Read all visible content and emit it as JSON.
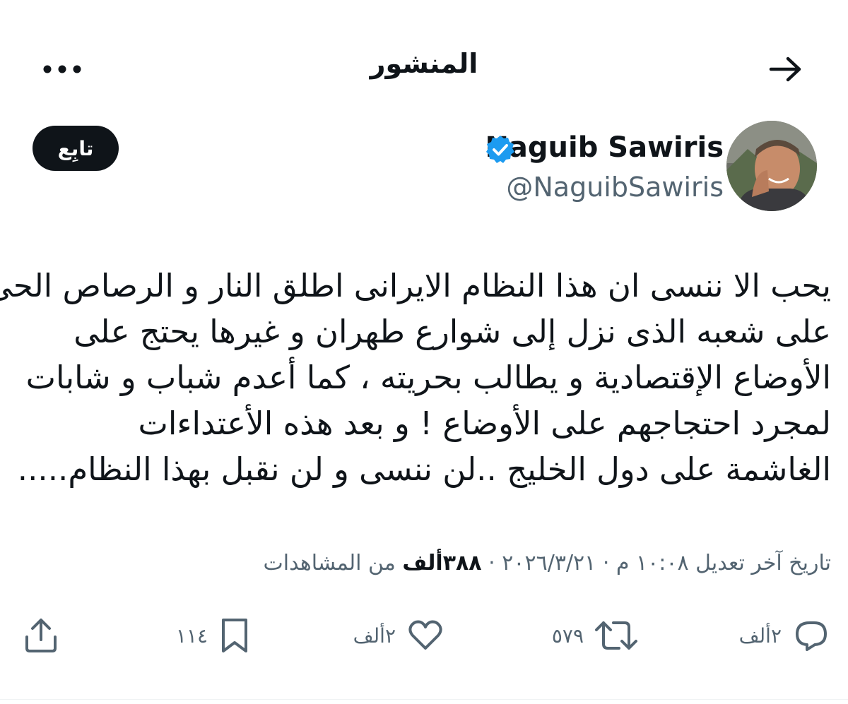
{
  "header": {
    "title": "المنشور",
    "back_icon": "arrow-right-icon",
    "more_icon": "more-horizontal-icon"
  },
  "author": {
    "display_name": "Naguib Sawiris",
    "handle": "@NaguibSawiris",
    "verified_color": "#1d9bf0",
    "follow_label": "تابِع"
  },
  "tweet": {
    "lines": [
      "يحب الا ننسى ان هذا النظام الايرانى اطلق النار و الرصاص الحى",
      "على شعبه الذى نزل إلى شوارع طهران و غيرها يحتج على",
      "الأوضاع الإقتصادية و يطالب بحريته ، كما أعدم شباب و شابات",
      "لمجرد احتجاجهم على الأوضاع ! و بعد هذه الأعتداءات",
      "الغاشمة على دول الخليج ..لن ننسى و لن نقبل بهذا النظام....."
    ]
  },
  "meta": {
    "edited_prefix": "تاريخ آخر تعديل",
    "time": "١٠:٠٨ م",
    "date": "٢٠٢٦/٣/٢١",
    "separator": "·",
    "views_count": "٣٨٨ألف",
    "views_suffix": "من المشاهدات"
  },
  "actions": {
    "reply_count": "٢ألف",
    "repost_count": "٥٧٩",
    "like_count": "٢ألف",
    "bookmark_count": "١١٤",
    "icon_color": "#536471"
  }
}
